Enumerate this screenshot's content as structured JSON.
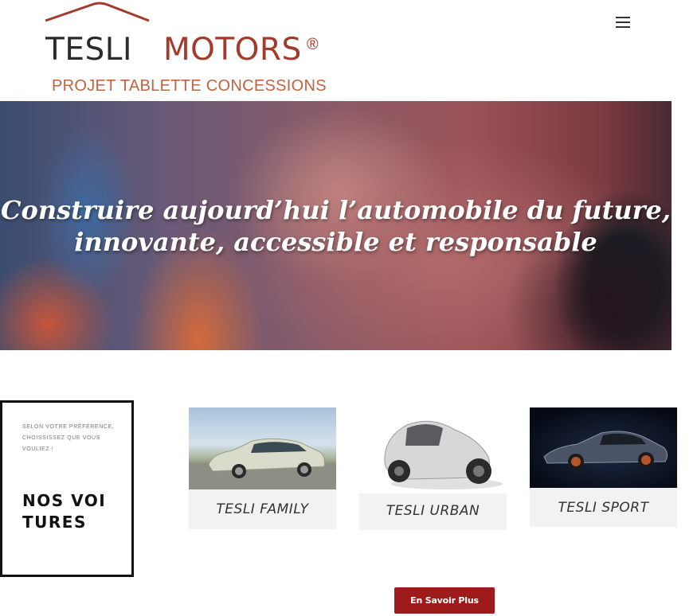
{
  "header": {
    "logo_word_1": "TESLI",
    "logo_word_2": "MOTORS",
    "logo_reg": "®",
    "logo_subtitle": "PROJET TABLETTE CONCESSIONS",
    "menu_icon": "hamburger-menu-icon"
  },
  "hero": {
    "line_1": "Construire aujourd’hui l’automobile du future,",
    "line_2": "innovante, accessible et responsable"
  },
  "cars_section": {
    "intro": "SELON VOTRE PRÉFÉRENCE, CHOISSISSEZ QUE VOUS VOULIEZ !",
    "title": "NOS VOITURES",
    "cars": [
      {
        "name": "TESLI FAMILY"
      },
      {
        "name": "TESLI URBAN"
      },
      {
        "name": "TESLI SPORT"
      }
    ],
    "cta_label": "En Savoir Plus"
  },
  "colors": {
    "brand_red": "#a33a2a",
    "subtitle_orange": "#c0633d",
    "cta_background": "#9e1b1b"
  }
}
